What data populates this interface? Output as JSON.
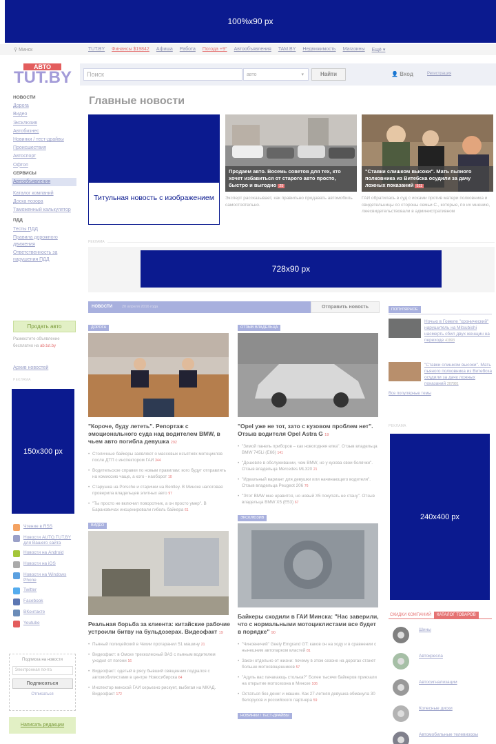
{
  "ads": {
    "top": "100%x90 px",
    "mid": "728x90 px",
    "left": "150x300 px",
    "right": "240x400 px",
    "label": "РЕКЛАМА"
  },
  "topnav": {
    "city": "Минск",
    "links": [
      {
        "t": "TUT.BY"
      },
      {
        "t": "Финансы $19842"
      },
      {
        "t": "Афиша"
      },
      {
        "t": "Работа"
      },
      {
        "t": "Погода +9°"
      },
      {
        "t": "Автообъявления"
      },
      {
        "t": "TAM.BY"
      },
      {
        "t": "Недвижимость"
      },
      {
        "t": "Магазины"
      },
      {
        "t": "Ещё ▾"
      }
    ]
  },
  "logo": {
    "top": "АВТО",
    "main": "TUT.BY"
  },
  "search": {
    "placeholder": "Поиск",
    "scope": "авто",
    "button": "Найти",
    "login": "Вход",
    "register": "Регистрация"
  },
  "leftnav": {
    "news_header": "НОВОСТИ",
    "news": [
      "Дорога",
      "Видео",
      "Эксклюзив",
      "Автобизнес",
      "Новинки / тест-драйвы",
      "Происшествия",
      "Автоспорт",
      "Офтоп"
    ],
    "services_header": "СЕРВИСЫ",
    "services_active": "Автообъявления",
    "services": [
      "Каталог компаний",
      "Доска позора",
      "Таможенный калькулятор"
    ],
    "pdd_header": "ПДД",
    "pdd": [
      "Тесты ПДД",
      "Правила дорожного движения",
      "Ответственность за нарушения ПДД"
    ]
  },
  "sell": {
    "button": "Продать авто",
    "text": "Разместите объявление бесплатно на",
    "site": "ab.tut.by"
  },
  "archive": "Архив новостей",
  "social": [
    {
      "t": "Чтение в RSS",
      "c": "#f4a261"
    },
    {
      "t": "Новости AUTO.TUT.BY для Вашего сайта",
      "c": "#9aa0c8"
    },
    {
      "t": "Новости на Android",
      "c": "#a4c639"
    },
    {
      "t": "Новости на iOS",
      "c": "#aaaaaa"
    },
    {
      "t": "Новости на Windows Phone",
      "c": "#5aa0e0"
    },
    {
      "t": "Twitter",
      "c": "#55acee"
    },
    {
      "t": "Facebook",
      "c": "#5b76b2"
    },
    {
      "t": "ВКонтакте",
      "c": "#6b8cb8"
    },
    {
      "t": "Youtube",
      "c": "#e35d5d"
    }
  ],
  "subscribe": {
    "title": "Подписка на новости",
    "placeholder": "Электронная почта",
    "button": "Подписаться",
    "unsub": "Отписаться"
  },
  "write": "Написать редакции",
  "main": {
    "title": "Главные новости",
    "feature_caption": "Титульная новость с изображением",
    "story1": {
      "caption": "Продаем авто. Восемь советов для тех, кто хочет избавиться от старого авто просто, быстро и выгодно",
      "count": "25",
      "desc": "Эксперт рассказывает, как правильно продавать автомобиль самостоятельно."
    },
    "story2": {
      "caption": "\"Ставки слишком высоки\". Мать пьяного полковника из Витебска осудили за дачу ложных показаний",
      "count": "511",
      "desc": "ГАИ обратилась в суд с исками против матери полковника и свидетельницы со стороны семьи С., которые, по их мнению, лжесвидетельствовали в административном"
    }
  },
  "newsbar": {
    "label": "НОВОСТИ",
    "date": "20 апреля 2016 года",
    "send": "Отправить новость"
  },
  "col1": {
    "tag": "ДОРОГА",
    "title": "\"Короче, буду лететь\". Репортаж с эмоционального суда над водителем BMW, в чьем авто погибла девушка",
    "count": "292",
    "items": [
      {
        "t": "Столичные байкеры заявляют о массовых изъятиях мотоциклов после ДТП с инспектором ГАИ",
        "c": "344"
      },
      {
        "t": "Водительское справки по новым правилам: кого будут отправлять на комиссию чаще, а кого - наоборот",
        "c": "10"
      },
      {
        "t": "Старушка на Porsche и старички на Bentley. В Минске налоговая проверила владельцев элитных авто",
        "c": "97"
      },
      {
        "t": "\"Ты просто не включил поворотник, а он просто умер\". В Барановичах инсценировали гибель байкера",
        "c": "61"
      }
    ],
    "tag2": "ВИДЕО",
    "title2": "Реальная борьба за клиента: китайские рабочие устроили битву на бульдозерах. Видеофакт",
    "count2": "19",
    "items2": [
      {
        "t": "Пьяный полицейский в Чехии протаранил 51 машину",
        "c": "21"
      },
      {
        "t": "Видеофакт: в Омске трехколесный ВАЗ с пьяным водителем уходил от погони",
        "c": "16"
      },
      {
        "t": "Видеофакт: одетый в рясу бывший священник подрался с автомобилистами в центре Новосибирска",
        "c": "64"
      },
      {
        "t": "Инспектор минской ГАИ серьезно рискует, выбегая на МКАД. Видеофакт",
        "c": "172"
      }
    ]
  },
  "col2": {
    "tag": "ОТЗЫВ ВЛАДЕЛЬЦА",
    "title": "\"Opel уже не тот, зато с кузовом проблем нет\". Отзыв водителя Opel Astra G",
    "count": "19",
    "items": [
      {
        "t": "\"Зимой панель приборов – как новогодняя елка\". Отзыв владельца BMW 745Li (E66)",
        "c": "141"
      },
      {
        "t": "\"Дешевле в обслуживании, чем BMW, но у кузова свои болячки\". Отзыв владельца Mercedes ML320",
        "c": "21"
      },
      {
        "t": "\"Идеальный вариант для девушки или начинающего водителя\". Отзыв владельца Peugeot 206",
        "c": "76"
      },
      {
        "t": "\"Этот BMW мне нравится, но новый X5 покупать не стану\". Отзыв владельца BMW X5 (E53)",
        "c": "67"
      }
    ],
    "tag2": "ЭКСКЛЮЗИВ",
    "title2": "Байкеры сходили в ГАИ Минска: \"Нас заверили, что с нормальными мотоциклистами все будет в порядке\"",
    "count2": "90",
    "items2": [
      {
        "t": "\"Чиновничий\" Geely Emgrand GT: каков он на ходу и в сравнении с нынешним автопарком властей",
        "c": "81"
      },
      {
        "t": "Закон отдельно от жизни: почему в этом сезоне на дорогах станет больше мотосвященников",
        "c": "57"
      },
      {
        "t": "\"Адуль вас пачакаюць столька?\" Более тысячи байкеров приехали на открытие мотосезона в Минске",
        "c": "106"
      },
      {
        "t": "Остаться без денег и машин. Как 27-летняя девушка обманула 30 белорусов и российского партнера",
        "c": "59"
      }
    ],
    "tag3": "НОВИНКИ / ТЕСТ-ДРАЙВЫ"
  },
  "popular": {
    "tab": "ПОПУЛЯРНОЕ",
    "items": [
      {
        "t": "Ночью в Гомеле \"хронический\" нарушитель на Mitsubishi насмерть сбил двух женщин на переходе",
        "c": "41993"
      },
      {
        "t": "\"Ставки слишком высоки\". Мать пьяного полковника из Витебска осудили за дачу ложных показаний",
        "c": "207981"
      }
    ],
    "all": "Все популярные темы"
  },
  "discounts": {
    "tab1": "СКИДКИ КОМПАНИЙ",
    "tab2": "КАТАЛОГ ТОВАРОВ",
    "items": [
      "Шины",
      "Автокресла",
      "Автосигнализации",
      "Колесные диски",
      "Автомобильные телевизоры"
    ]
  }
}
